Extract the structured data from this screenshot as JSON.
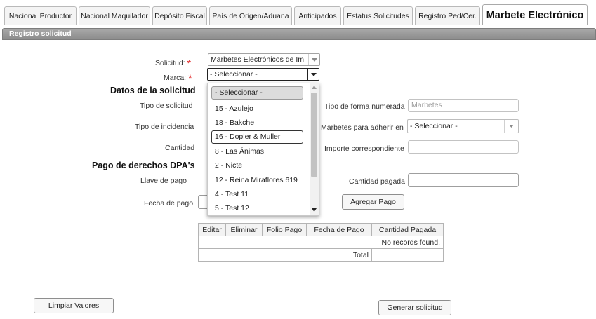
{
  "tabs": [
    {
      "label": "Nacional Productor",
      "active": false
    },
    {
      "label": "Nacional Maquilador",
      "active": false
    },
    {
      "label": "Depósito Fiscal",
      "active": false
    },
    {
      "label": "País de Origen/Aduana",
      "active": false
    },
    {
      "label": "Anticipados",
      "active": false
    },
    {
      "label": "Estatus Solicitudes",
      "active": false
    },
    {
      "label": "Registro Ped/Cer.",
      "active": false
    },
    {
      "label": "Marbete Electrónico",
      "active": true
    }
  ],
  "panel": {
    "title": "Registro solicitud"
  },
  "form": {
    "solicitud_label": "Solicitud:",
    "solicitud_value": "Marbetes Electrónicos de Im",
    "marca_label": "Marca:",
    "marca_value": "- Seleccionar -",
    "required_mark": "*"
  },
  "datos": {
    "title": "Datos de la solicitud",
    "tipo_solicitud_label": "Tipo de solicitud",
    "tipo_incidencia_label": "Tipo de incidencia",
    "cantidad_label": "Cantidad",
    "tipo_forma_label": "Tipo de forma numerada",
    "tipo_forma_value": "Marbetes",
    "adherir_label": "Marbetes para adherir en",
    "adherir_value": "- Seleccionar -",
    "importe_label": "Importe correspondiente"
  },
  "pago": {
    "title": "Pago de derechos DPA's",
    "llave_label": "Llave de pago",
    "fecha_label": "Fecha de pago",
    "cantidad_pagada_label": "Cantidad pagada",
    "agregar_button": "Agregar Pago"
  },
  "dropdown": {
    "items": [
      "- Seleccionar -",
      "15 - Azulejo",
      "18 - Bakche",
      "16 - Dopler & Muller",
      "8 - Las Ánimas",
      "2 - Nicte",
      "12 - Reina Miraflores 619",
      "4 - Test 11",
      "5 - Test 12"
    ],
    "selected_index": 0,
    "hover_index": 3
  },
  "table": {
    "columns": [
      "Editar",
      "Eliminar",
      "Folio Pago",
      "Fecha de Pago",
      "Cantidad Pagada"
    ],
    "empty_message": "No records found.",
    "total_label": "Total"
  },
  "actions": {
    "limpiar": "Limpiar Valores",
    "generar": "Generar solicitud"
  }
}
